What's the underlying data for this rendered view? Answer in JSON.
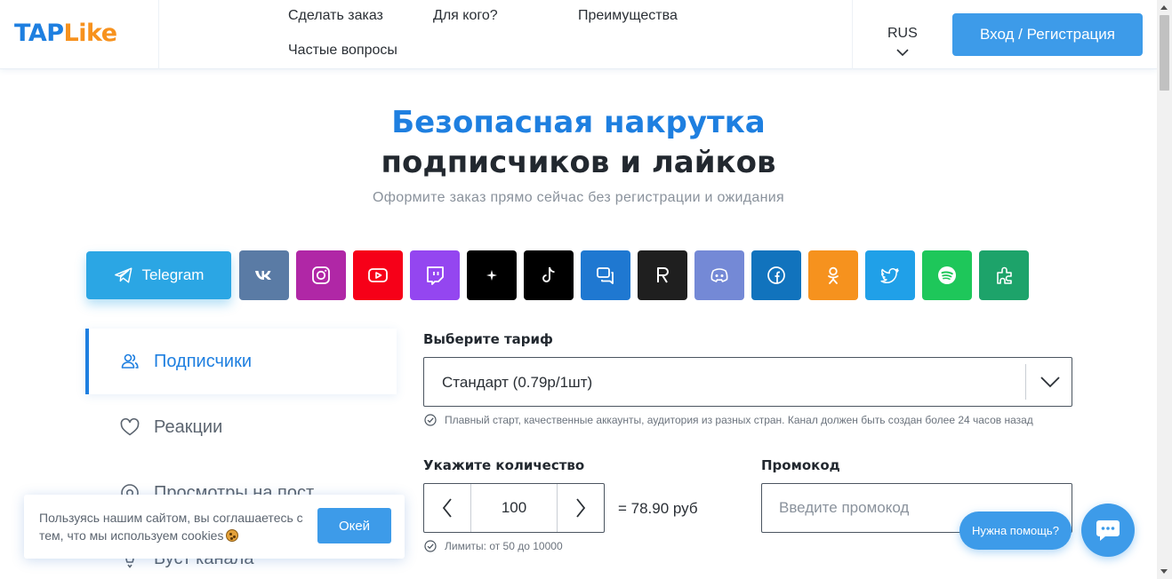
{
  "header": {
    "logo": {
      "part1": "TAP",
      "part2": "Like"
    },
    "nav": [
      "Сделать заказ",
      "Для кого?",
      "Преимущества",
      "Частые вопросы"
    ],
    "lang": "RUS",
    "login_label": "Вход / Регистрация"
  },
  "hero": {
    "title_line1": "Безопасная накрутка",
    "title_line2": "подписчиков и лайков",
    "subtitle": "Оформите заказ прямо сейчас без регистрации и ожидания"
  },
  "platforms": [
    {
      "name": "telegram",
      "label": "Telegram",
      "color": "#2ba6e4",
      "active": true
    },
    {
      "name": "vk",
      "icon": "vk-icon",
      "color": "#5a7ba5"
    },
    {
      "name": "instagram",
      "icon": "instagram-icon",
      "color": "#b027a6"
    },
    {
      "name": "youtube",
      "icon": "youtube-icon",
      "color": "#f60018"
    },
    {
      "name": "twitch",
      "icon": "twitch-icon",
      "color": "#9446f0"
    },
    {
      "name": "threads",
      "icon": "sparkle-icon",
      "color": "#000000"
    },
    {
      "name": "tiktok",
      "icon": "tiktok-icon",
      "color": "#000000"
    },
    {
      "name": "messenger",
      "icon": "chat-bubbles-icon",
      "color": "#1f78d1"
    },
    {
      "name": "rutube",
      "icon": "r-letter-icon",
      "color": "#1f1f1f"
    },
    {
      "name": "discord",
      "icon": "discord-icon",
      "color": "#7489d6"
    },
    {
      "name": "facebook",
      "icon": "facebook-icon",
      "color": "#1173bd"
    },
    {
      "name": "odnoklassniki",
      "icon": "ok-icon",
      "color": "#f6921e"
    },
    {
      "name": "twitter",
      "icon": "twitter-icon",
      "color": "#20a0e8"
    },
    {
      "name": "spotify",
      "icon": "spotify-icon",
      "color": "#1ec75a"
    },
    {
      "name": "other",
      "icon": "puzzle-icon",
      "color": "#1da36a"
    }
  ],
  "categories": [
    {
      "label": "Подписчики",
      "icon": "users-icon",
      "active": true
    },
    {
      "label": "Реакции",
      "icon": "heart-icon"
    },
    {
      "label": "Просмотры на пост",
      "icon": "eye-icon"
    },
    {
      "label": "Буст канала",
      "icon": "rocket-icon"
    }
  ],
  "form": {
    "tariff_label": "Выберите тариф",
    "tariff_value": "Стандарт (0.79р/1шт)",
    "tariff_hint": "Плавный старт, качественные аккаунты, аудитория из разных стран. Канал должен быть создан более 24 часов назад",
    "quantity_label": "Укажите количество",
    "quantity_value": "100",
    "total": "= 78.90 руб",
    "quantity_hint": "Лимиты: от 50 до 10000",
    "promo_label": "Промокод",
    "promo_placeholder": "Введите промокод"
  },
  "cookie": {
    "text": "Пользуясь нашим сайтом, вы соглашаетесь с тем, что мы используем cookies",
    "ok_label": "Окей"
  },
  "help": {
    "bubble": "Нужна помощь?"
  }
}
